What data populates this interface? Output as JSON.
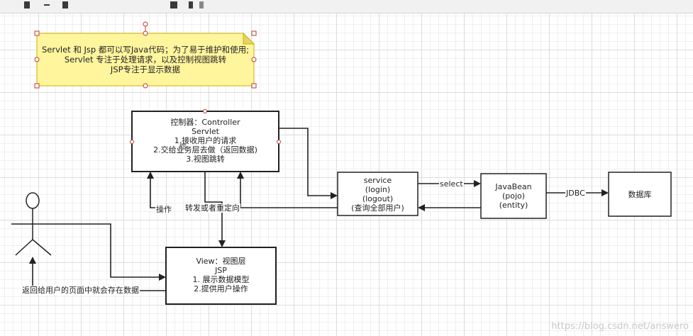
{
  "note": {
    "lines": [
      "Servlet 和 Jsp  都可以写Java代码；为了易于维护和使用;",
      "Servlet 专注于处理请求，以及控制视图跳转",
      "JSP专注于显示数据"
    ],
    "fill": "#fff59d"
  },
  "controller": {
    "lines": [
      "控制器：Controller",
      "Servlet",
      "1.接收用户的请求",
      "2.交给业务层去做（返回数据)",
      "3.视图跳转"
    ]
  },
  "view": {
    "lines": [
      "View：视图层",
      "JSP",
      "1. 展示数据模型",
      "2.提供用户操作"
    ]
  },
  "service": {
    "lines": [
      "service",
      "(login)",
      "(logout)",
      "(查询全部用户)"
    ]
  },
  "javabean": {
    "lines": [
      "JavaBean",
      "(pojo)",
      "(entity)"
    ]
  },
  "database": {
    "label": "数据库"
  },
  "edges": {
    "select": "select",
    "jdbc": "JDBC",
    "operate": "操作",
    "forward": "转发或者重定向",
    "return_user": "返回给用户的页面中就会存在数据",
    "overlap_char": "给"
  },
  "watermark": "https://blog.csdn.net/answero"
}
